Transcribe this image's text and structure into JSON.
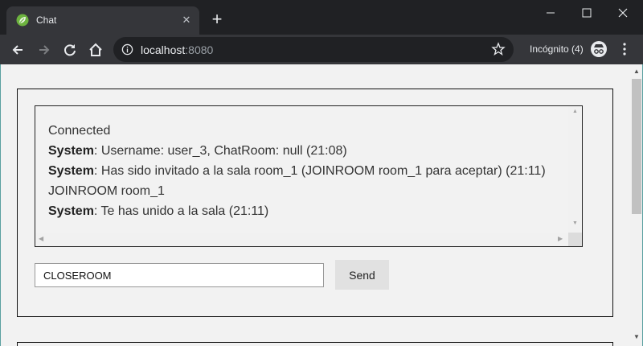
{
  "browser": {
    "tab_title": "Chat",
    "url_host": "localhost",
    "url_port": ":8080",
    "incognito_label": "Incógnito (4)",
    "icons": [
      "spring-leaf-icon",
      "close-icon",
      "plus-icon",
      "minimize-icon",
      "maximize-icon",
      "window-close-icon",
      "back-arrow-icon",
      "forward-arrow-icon",
      "reload-icon",
      "home-icon",
      "info-icon",
      "star-icon",
      "incognito-icon",
      "kebab-menu-icon"
    ]
  },
  "chat": {
    "messages": [
      {
        "sender": "",
        "text": "Connected"
      },
      {
        "sender": "System",
        "text": ": Username: user_3, ChatRoom: null (21:08)"
      },
      {
        "sender": "System",
        "text": ": Has sido invitado a la sala room_1 (JOINROOM room_1 para aceptar) (21:11)"
      },
      {
        "sender": "",
        "text": "JOINROOM room_1"
      },
      {
        "sender": "System",
        "text": ": Te has unido a la sala (21:11)"
      }
    ],
    "input_value": "CLOSEROOM",
    "send_label": "Send"
  },
  "colors": {
    "tab_bg": "#35363a",
    "titlebar_bg": "#202124",
    "page_bg": "#f2f2f2",
    "leaf_green": "#6db33f"
  }
}
